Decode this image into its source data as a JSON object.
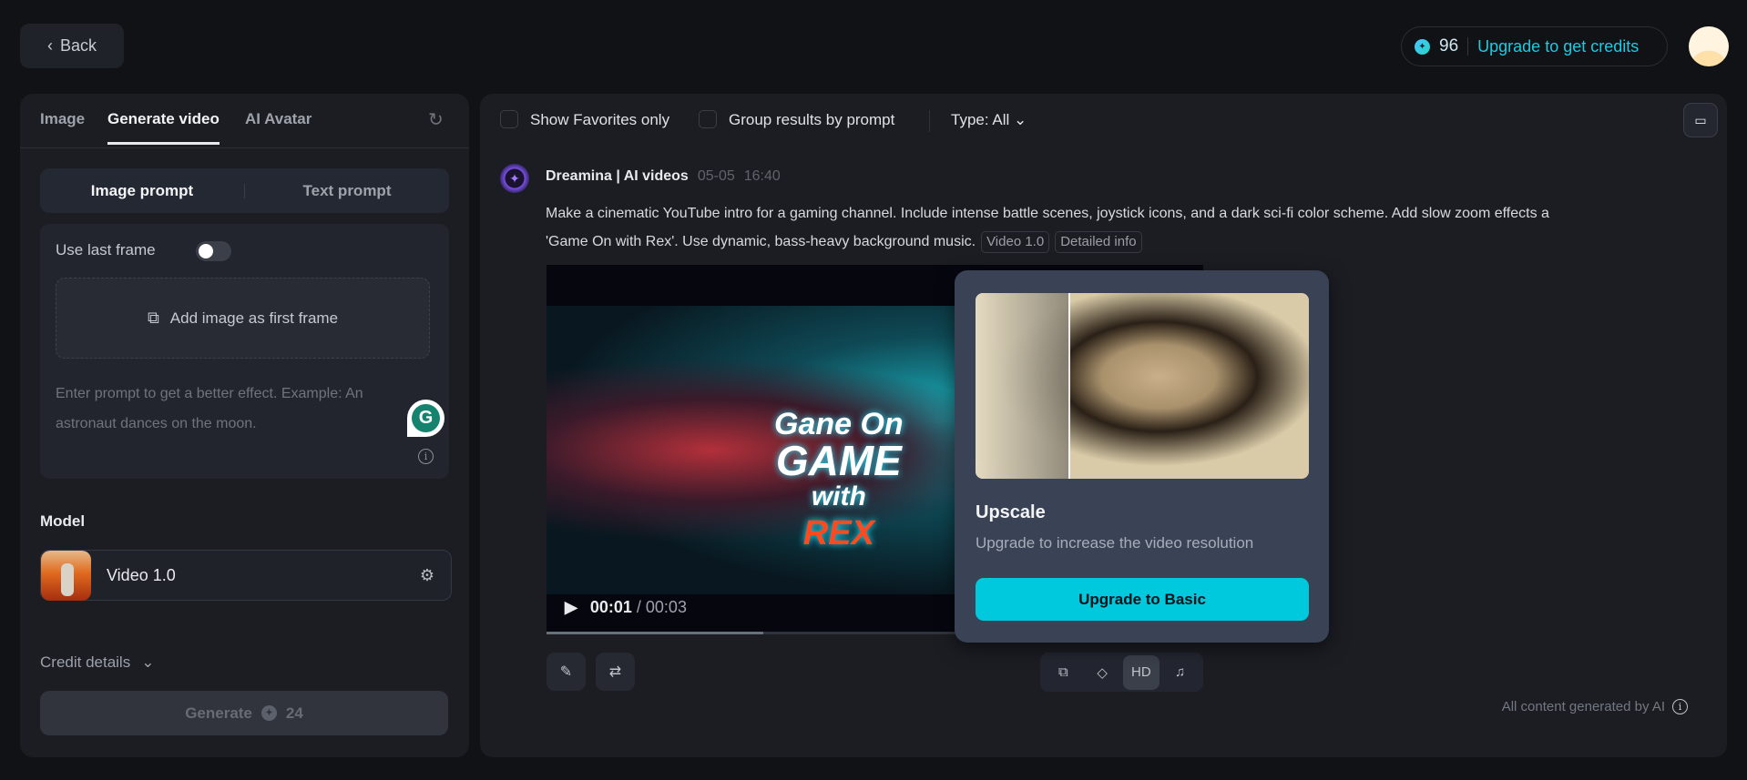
{
  "header": {
    "back_label": "Back",
    "credits": "96",
    "upgrade_label": "Upgrade to get credits"
  },
  "left": {
    "tabs": [
      "Image",
      "Generate video",
      "AI Avatar"
    ],
    "prompt_modes": [
      "Image prompt",
      "Text prompt"
    ],
    "use_last_frame_label": "Use last frame",
    "use_last_frame_on": false,
    "add_image_label": "Add image as first frame",
    "prompt_placeholder": "Enter prompt to get a better effect. Example: An astronaut dances on the moon.",
    "model_label": "Model",
    "model_name": "Video 1.0",
    "credit_details_label": "Credit details",
    "generate_label": "Generate",
    "generate_cost": "24"
  },
  "toolbar": {
    "favorites_label": "Show Favorites only",
    "group_label": "Group results by prompt",
    "type_label": "Type: All"
  },
  "result": {
    "author": "Dreamina | AI videos",
    "date": "05-05",
    "time": "16:40",
    "prompt": "Make a cinematic YouTube intro for a gaming channel. Include intense battle scenes, joystick icons, and a dark sci-fi color scheme. Add slow zoom effects a",
    "prompt2": "'Game On with Rex'. Use dynamic, bass-heavy background music.",
    "tags": [
      "Video 1.0",
      "Detailed info"
    ],
    "video": {
      "current": "00:01",
      "total": "/ 00:03",
      "progress": 0.33,
      "overlay_text": [
        "Gane On",
        "GAME",
        "with",
        "REX"
      ]
    },
    "action_hd": "HD",
    "footer": "All content generated by AI"
  },
  "popup": {
    "title": "Upscale",
    "description": "Upgrade to increase the video resolution",
    "button": "Upgrade to Basic"
  },
  "colors": {
    "accent": "#00c8dd",
    "link": "#1ecbe1"
  }
}
